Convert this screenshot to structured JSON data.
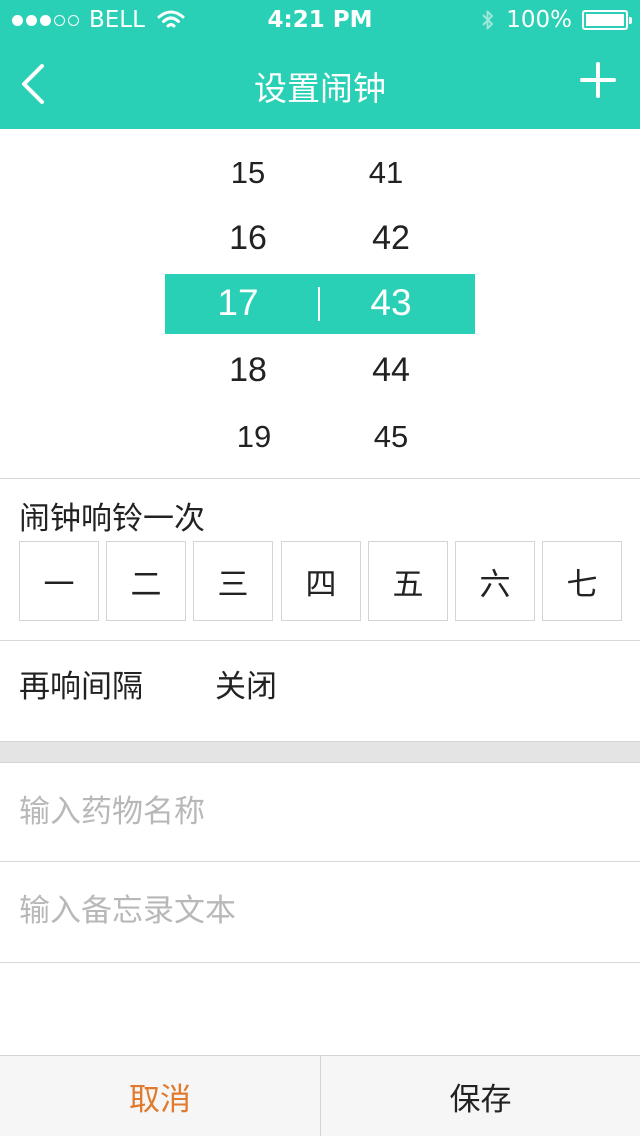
{
  "status_bar": {
    "carrier": "BELL",
    "time": "4:21 PM",
    "battery": "100%",
    "signal_icon": "signal-dots-icon",
    "wifi_icon": "wifi-icon",
    "bluetooth_icon": "bluetooth-icon",
    "battery_icon": "battery-icon"
  },
  "nav": {
    "title": "设置闹钟",
    "back_icon": "chevron-left-icon",
    "add_icon": "plus-icon"
  },
  "picker": {
    "hours": [
      "15",
      "16",
      "17",
      "18",
      "19"
    ],
    "minutes": [
      "41",
      "42",
      "43",
      "44",
      "45"
    ],
    "selected_hour": "17",
    "selected_minute": "43"
  },
  "repeat": {
    "label": "闹钟响铃一次",
    "days": [
      "一",
      "二",
      "三",
      "四",
      "五",
      "六",
      "七"
    ]
  },
  "snooze": {
    "label": "再响间隔",
    "value": "关闭"
  },
  "inputs": {
    "medicine_placeholder": "输入药物名称",
    "memo_placeholder": "输入备忘录文本"
  },
  "footer": {
    "cancel_label": "取消",
    "save_label": "保存"
  },
  "colors": {
    "accent": "#2ad0b5",
    "cancel_text": "#e07a2c"
  }
}
